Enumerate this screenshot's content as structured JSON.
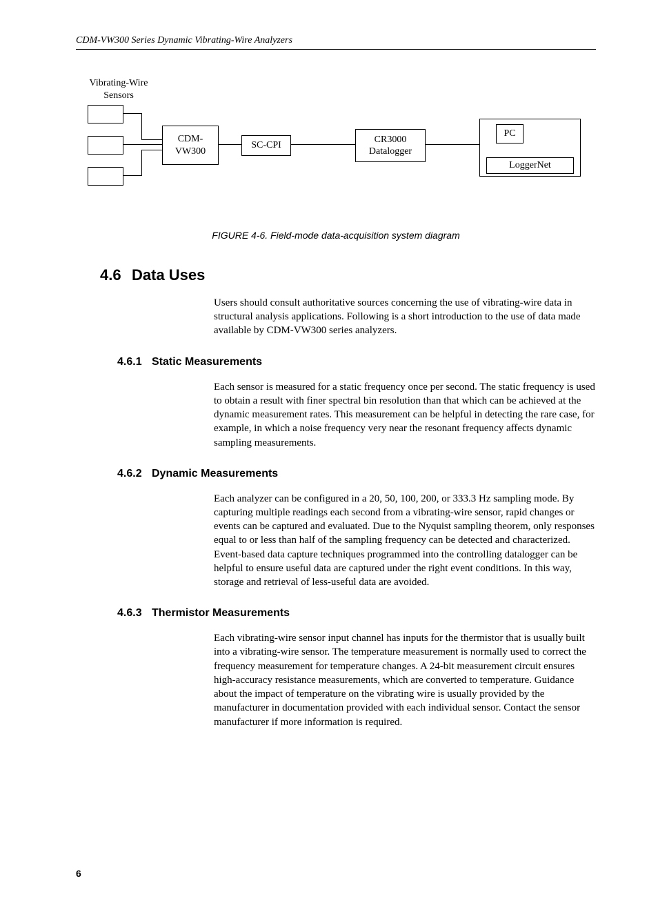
{
  "header": "CDM-VW300 Series Dynamic Vibrating-Wire Analyzers",
  "diagram": {
    "sensors_label": "Vibrating-Wire\nSensors",
    "cdm": "CDM-\nVW300",
    "sccpi": "SC-CPI",
    "cr3000": "CR3000\nDatalogger",
    "pc": "PC",
    "loggernet": "LoggerNet"
  },
  "figure_caption": "FIGURE 4-6.  Field-mode data-acquisition system diagram",
  "section": {
    "num": "4.6",
    "title": "Data Uses",
    "intro": "Users should consult authoritative sources concerning the use of vibrating-wire data in structural analysis applications.  Following is a short introduction to the use of data made available by CDM-VW300 series analyzers."
  },
  "sub1": {
    "num": "4.6.1",
    "title": "Static Measurements",
    "body": "Each sensor is measured for a static frequency once per second.  The static frequency is used to obtain a result with finer spectral bin resolution than that which can be achieved at the dynamic measurement rates.  This measurement can be helpful in detecting the rare case, for example, in which a noise frequency very near the resonant frequency affects dynamic sampling measurements."
  },
  "sub2": {
    "num": "4.6.2",
    "title": "Dynamic Measurements",
    "body": "Each analyzer can be configured in a 20, 50, 100, 200, or 333.3 Hz sampling mode.  By capturing multiple readings each second from a vibrating-wire sensor, rapid changes or events can be captured and evaluated.  Due to the Nyquist sampling theorem, only responses equal to or less than half of the sampling frequency can be detected and characterized.  Event-based data capture techniques programmed into the controlling datalogger can be helpful to ensure useful data are captured under the right event conditions.  In this way, storage and retrieval of less-useful data are avoided."
  },
  "sub3": {
    "num": "4.6.3",
    "title": "Thermistor Measurements",
    "body": "Each vibrating-wire sensor input channel has inputs for the thermistor that is usually built into a vibrating-wire sensor.  The temperature measurement is normally used to correct the frequency measurement for temperature changes.  A 24-bit measurement circuit ensures high-accuracy resistance measurements, which are converted to temperature.  Guidance about the impact of temperature on the vibrating wire is usually provided by the manufacturer in documentation provided with each individual sensor.  Contact the sensor manufacturer if more information is required."
  },
  "page_number": "6"
}
